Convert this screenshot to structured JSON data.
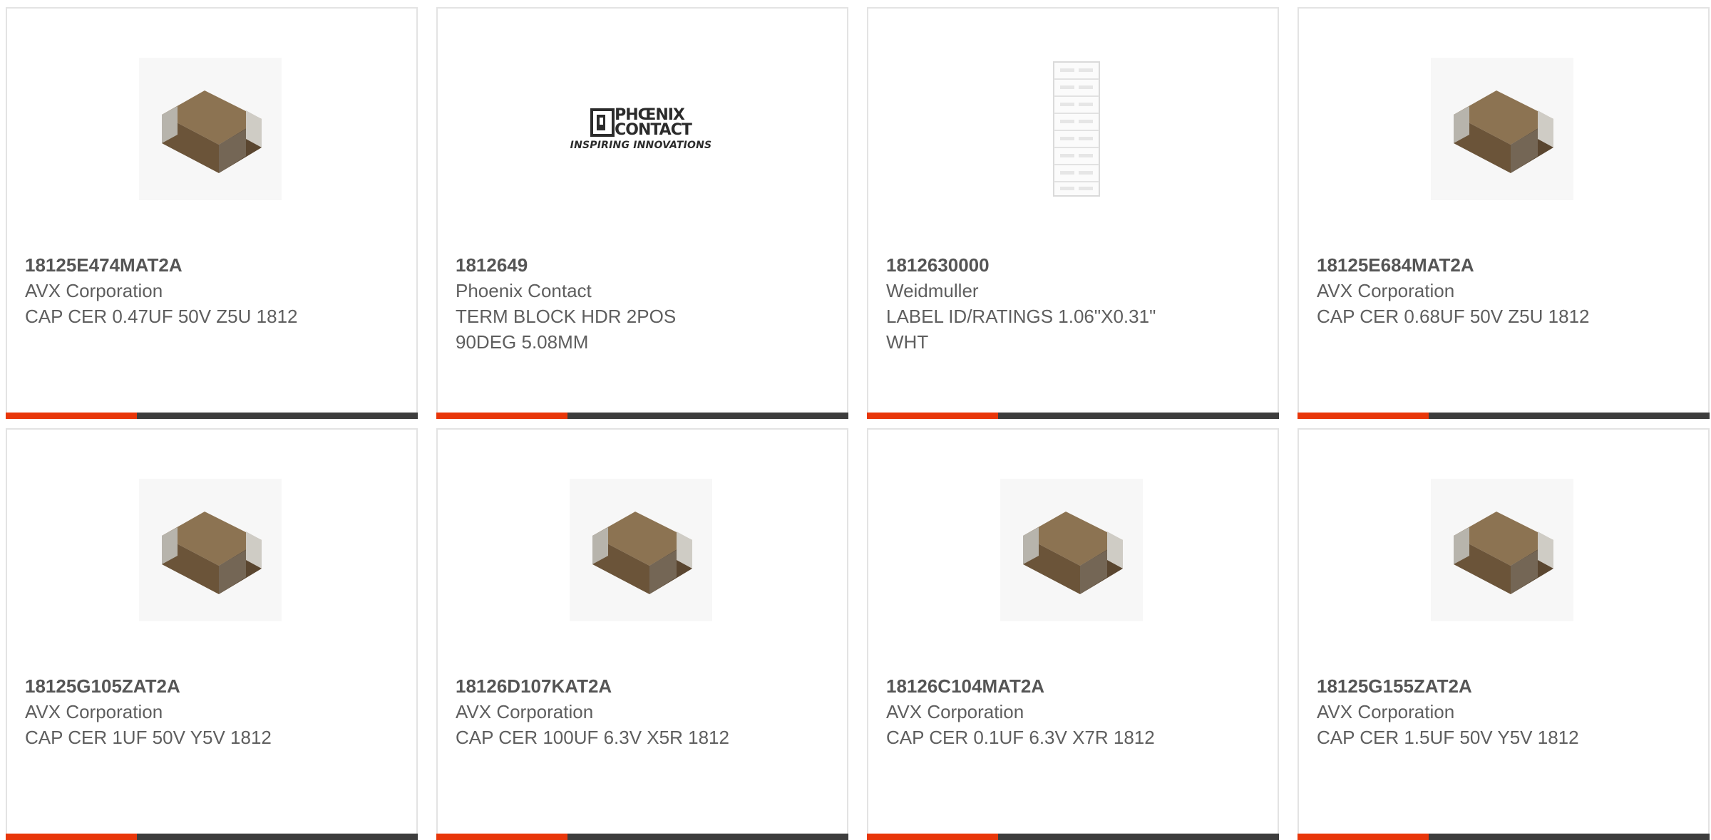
{
  "products": [
    {
      "part": "18125E474MAT2A",
      "manufacturer": "AVX Corporation",
      "description": "CAP CER 0.47UF 50V Z5U 1812",
      "image": "ceramic-capacitor-icon"
    },
    {
      "part": "1812649",
      "manufacturer": "Phoenix Contact",
      "description": "TERM BLOCK HDR 2POS 90DEG 5.08MM",
      "image": "phoenix-contact-logo",
      "logo": {
        "line1": "PHŒNIX",
        "line2": "CONTACT",
        "slogan": "INSPIRING INNOVATIONS"
      }
    },
    {
      "part": "1812630000",
      "manufacturer": "Weidmuller",
      "description": "LABEL ID/RATINGS 1.06\"X0.31\" WHT",
      "image": "label-strip-icon"
    },
    {
      "part": "18125E684MAT2A",
      "manufacturer": "AVX Corporation",
      "description": "CAP CER 0.68UF 50V Z5U 1812",
      "image": "ceramic-capacitor-icon"
    },
    {
      "part": "18125G105ZAT2A",
      "manufacturer": "AVX Corporation",
      "description": "CAP CER 1UF 50V Y5V 1812",
      "image": "ceramic-capacitor-icon"
    },
    {
      "part": "18126D107KAT2A",
      "manufacturer": "AVX Corporation",
      "description": "CAP CER 100UF 6.3V X5R 1812",
      "image": "ceramic-capacitor-icon"
    },
    {
      "part": "18126C104MAT2A",
      "manufacturer": "AVX Corporation",
      "description": "CAP CER 0.1UF 6.3V X7R 1812",
      "image": "ceramic-capacitor-icon"
    },
    {
      "part": "18125G155ZAT2A",
      "manufacturer": "AVX Corporation",
      "description": "CAP CER 1.5UF 50V Y5V 1812",
      "image": "ceramic-capacitor-icon"
    }
  ],
  "colors": {
    "accent": "#e8360a",
    "bar": "#3d3d3d",
    "text": "#5e5e5e",
    "border": "#e3e3e3"
  }
}
